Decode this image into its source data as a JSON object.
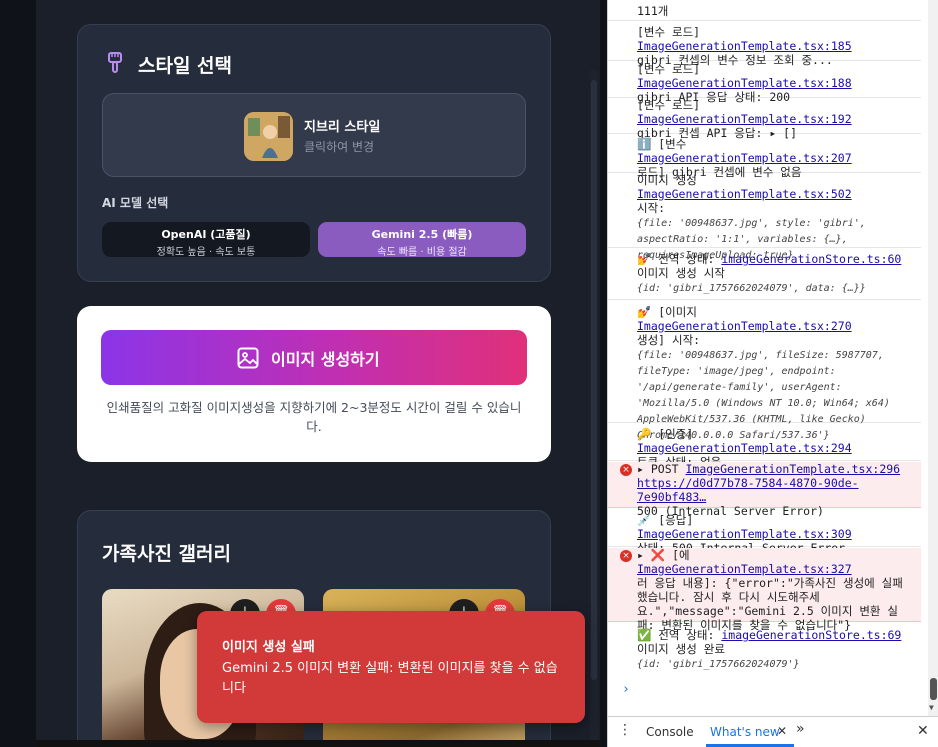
{
  "app": {
    "style_card": {
      "title": "스타일 선택",
      "selected_style_name": "지브리 스타일",
      "selected_style_sub": "클릭하여 변경",
      "model_label": "AI 모델 선택",
      "models": [
        {
          "name": "OpenAI (고품질)",
          "desc": "정확도 높음 · 속도 보통",
          "selected": false
        },
        {
          "name": "Gemini 2.5 (빠름)",
          "desc": "속도 빠름 · 비용 절감",
          "selected": true
        }
      ]
    },
    "generate": {
      "button_label": "이미지 생성하기",
      "note": "인쇄품질의 고화질 이미지생성을 지향하기에 2~3분정도 시간이 걸릴 수 있습니다."
    },
    "gallery": {
      "title": "가족사진 갤러리"
    },
    "toast": {
      "title": "이미지 생성 실패",
      "message": "Gemini 2.5 이미지 변환 실패: 변환된 이미지를 찾을 수 없습니다"
    }
  },
  "devtools": {
    "logs": [
      {
        "text": "111개",
        "src": "",
        "type": "log"
      },
      {
        "text": "[변수 로드] ",
        "src": "ImageGenerationTemplate.tsx:185",
        "text2": "gibri 컨셉의 변수 정보 조회 중...",
        "type": "log"
      },
      {
        "text": "[변수 로드] ",
        "src": "ImageGenerationTemplate.tsx:188",
        "text2": "gibri API 응답 상태: 200",
        "type": "log"
      },
      {
        "text": "[변수 로드] ",
        "src": "ImageGenerationTemplate.tsx:192",
        "text2": "gibri 컨셉 API 응답: ▸ []",
        "type": "log"
      },
      {
        "text": "ℹ️ [변수 ",
        "src": "ImageGenerationTemplate.tsx:207",
        "text2": "로드] gibri 컨셉에 변수 없음",
        "type": "log"
      },
      {
        "text": "이미지 생성 ",
        "src": "ImageGenerationTemplate.tsx:502",
        "text2": "시작:",
        "obj": "{file: '00948637.jpg', style: 'gibri', aspectRatio: '1:1', variables: {…}, requiresImageUpload: true}",
        "type": "log"
      },
      {
        "text": "💅 전역 상태: ",
        "src": "imageGenerationStore.ts:60",
        "text2": "이미지 생성 시작",
        "obj": "{id: 'gibri_1757662024079', data: {…}}",
        "type": "log"
      },
      {
        "text": "💅 [이미지 ",
        "src": "ImageGenerationTemplate.tsx:270",
        "text2": "생성] 시작:",
        "obj": "{file: '00948637.jpg', fileSize: 5987707, fileType: 'image/jpeg', endpoint: '/api/generate-family', userAgent: 'Mozilla/5.0 (Windows NT 10.0; Win64; x64) AppleWebKit/537.36 (KHTML, like Gecko) Chrome/140.0.0.0 Safari/537.36'}",
        "type": "log"
      },
      {
        "text": "🔑 [인증] ",
        "src": "ImageGenerationTemplate.tsx:294",
        "text2": "토큰 상태: 없음",
        "type": "log"
      },
      {
        "text": "▸ POST ",
        "src": "ImageGenerationTemplate.tsx:296",
        "text2": "https://d0d77b78-7584-4870-90de-7e90bf483…",
        "text3": "500 (Internal Server Error)",
        "type": "error"
      },
      {
        "text": "💉 [응답] ",
        "src": "ImageGenerationTemplate.tsx:309",
        "text2": "상태: 500 Internal Server Error",
        "type": "log"
      },
      {
        "text": "▸ ❌ [에 ",
        "src": "ImageGenerationTemplate.tsx:327",
        "text2": "러 응답 내용]: {\"error\":\"가족사진 생성에 실패했습니다. 잠시 후 다시 시도해주세요.\",\"message\":\"Gemini 2.5 이미지 변환 실패: 변환된 이미지를 찾을 수 없습니다\"}",
        "type": "error"
      },
      {
        "text": "✅ 전역 상태: ",
        "src": "imageGenerationStore.ts:69",
        "text2": "이미지 생성 완료",
        "obj": "{id: 'gibri_1757662024079'}",
        "type": "log"
      }
    ],
    "drawer": {
      "tab_console": "Console",
      "tab_whatsnew": "What's new"
    }
  },
  "colors": {
    "accent_purple": "#8a5cc0",
    "error_red": "#d23a3a",
    "link_blue": "#1a0dab"
  }
}
